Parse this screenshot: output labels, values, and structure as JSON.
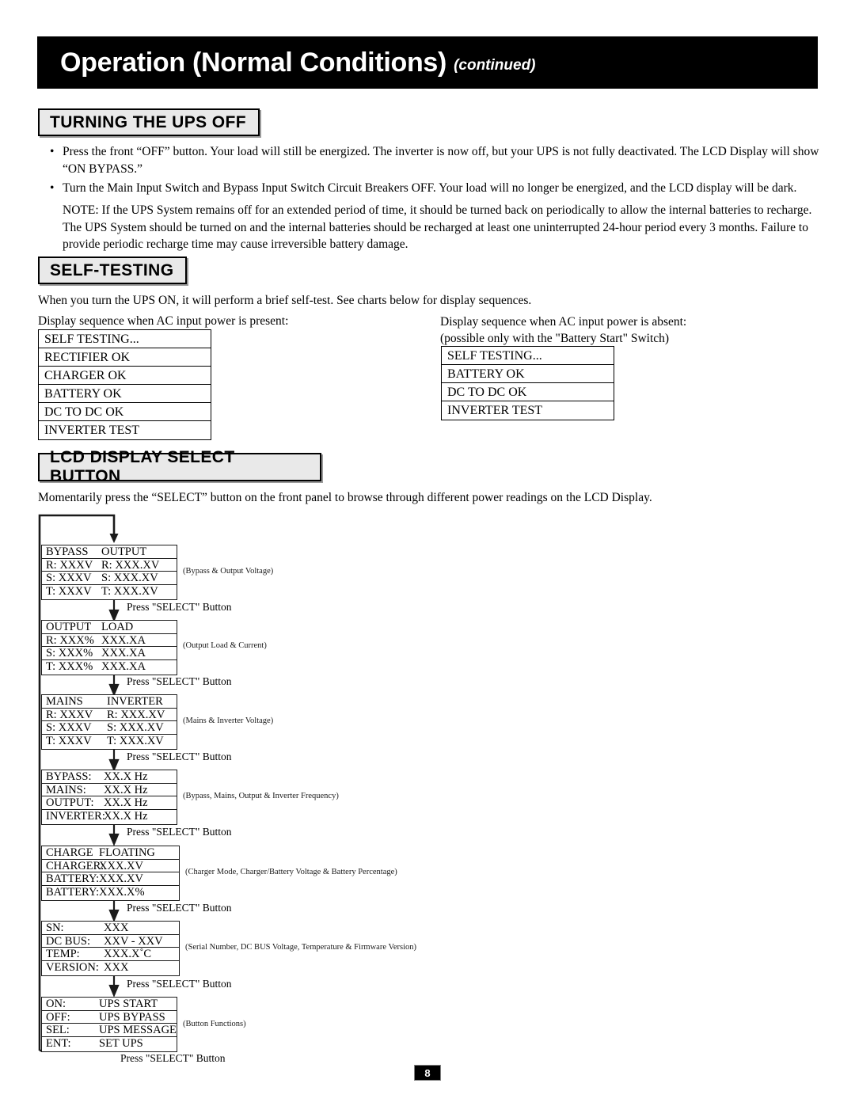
{
  "header": {
    "title": "Operation (Normal Conditions)",
    "continued": "(continued)"
  },
  "sections": {
    "turning_off": {
      "heading": "TURNING  THE UPS OFF",
      "bullet1": "Press the front “OFF” button.  Your load will still be energized. The inverter is now off, but your UPS is not fully deactivated. The LCD Display will show “ON BYPASS.”",
      "bullet2": "Turn the Main Input Switch and Bypass Input Switch Circuit Breakers OFF. Your load will no longer be energized, and the LCD display will be dark.",
      "note": "NOTE: If the UPS System remains off for an extended period of time, it should be turned back on periodically to allow the internal batteries to recharge. The UPS System should be turned on and the internal batteries should be recharged at least one uninterrupted 24-hour period every 3 months. Failure to provide periodic recharge time may cause irreversible battery damage.",
      "bullet_glyph": "•"
    },
    "self_testing": {
      "heading": "SELF-TESTING",
      "intro": "When you turn the UPS ON, it will perform a brief self-test. See charts below for display sequences.",
      "present_caption": "Display sequence when AC input power is present:",
      "absent_caption_line1": "Display sequence when AC input power is absent:",
      "absent_caption_line2": "(possible only with the \"Battery Start\" Switch)",
      "present_rows": [
        "SELF TESTING...",
        "RECTIFIER OK",
        "CHARGER OK",
        "BATTERY OK",
        "DC TO DC OK",
        "INVERTER TEST"
      ],
      "absent_rows": [
        "SELF TESTING...",
        "BATTERY OK",
        "DC TO DC OK",
        "INVERTER TEST"
      ]
    },
    "lcd_select": {
      "heading": "LCD DISPLAY SELECT BUTTON",
      "intro": "Momentarily press the “SELECT” button on the front panel to browse through different power readings on the LCD Display.",
      "press_label": "Press \"SELECT\" Button",
      "screens": [
        {
          "annotation": "(Bypass & Output Voltage)",
          "rows": [
            [
              "BYPASS",
              "OUTPUT"
            ],
            [
              "R: XXXV",
              "R: XXX.XV"
            ],
            [
              "S: XXXV",
              "S: XXX.XV"
            ],
            [
              "T: XXXV",
              "T: XXX.XV"
            ]
          ]
        },
        {
          "annotation": "(Output Load & Current)",
          "rows": [
            [
              "OUTPUT",
              "LOAD"
            ],
            [
              "R: XXX%",
              "XXX.XA"
            ],
            [
              "S: XXX%",
              "XXX.XA"
            ],
            [
              "T: XXX%",
              "XXX.XA"
            ]
          ]
        },
        {
          "annotation": "(Mains & Inverter Voltage)",
          "rows": [
            [
              "MAINS",
              "INVERTER"
            ],
            [
              "R: XXXV",
              "R: XXX.XV"
            ],
            [
              "S: XXXV",
              "S: XXX.XV"
            ],
            [
              "T: XXXV",
              "T: XXX.XV"
            ]
          ]
        },
        {
          "annotation": "(Bypass, Mains, Output & Inverter Frequency)",
          "rows": [
            [
              "BYPASS:",
              "XX.X Hz"
            ],
            [
              "MAINS:",
              "XX.X Hz"
            ],
            [
              "OUTPUT:",
              "XX.X Hz"
            ],
            [
              "INVERTER:",
              "XX.X Hz"
            ]
          ]
        },
        {
          "annotation": "(Charger Mode, Charger/Battery Voltage & Battery Percentage)",
          "rows": [
            [
              "CHARGE",
              "FLOATING"
            ],
            [
              "CHARGER:",
              "XXX.XV"
            ],
            [
              "BATTERY:",
              "XXX.XV"
            ],
            [
              "BATTERY:",
              "XXX.X%"
            ]
          ]
        },
        {
          "annotation": "(Serial Number, DC BUS Voltage, Temperature & Firmware Version)",
          "rows": [
            [
              "SN:",
              "XXX"
            ],
            [
              "DC BUS:",
              "XXV - XXV"
            ],
            [
              "TEMP:",
              "XXX.X˚C"
            ],
            [
              "VERSION:",
              "XXX"
            ]
          ]
        },
        {
          "annotation": "(Button Functions)",
          "rows": [
            [
              "ON:",
              "UPS START"
            ],
            [
              "OFF:",
              "UPS BYPASS"
            ],
            [
              "SEL:",
              "UPS MESSAGE"
            ],
            [
              "ENT:",
              "SET UPS"
            ]
          ]
        }
      ]
    }
  },
  "footer": {
    "page_number": "8"
  }
}
